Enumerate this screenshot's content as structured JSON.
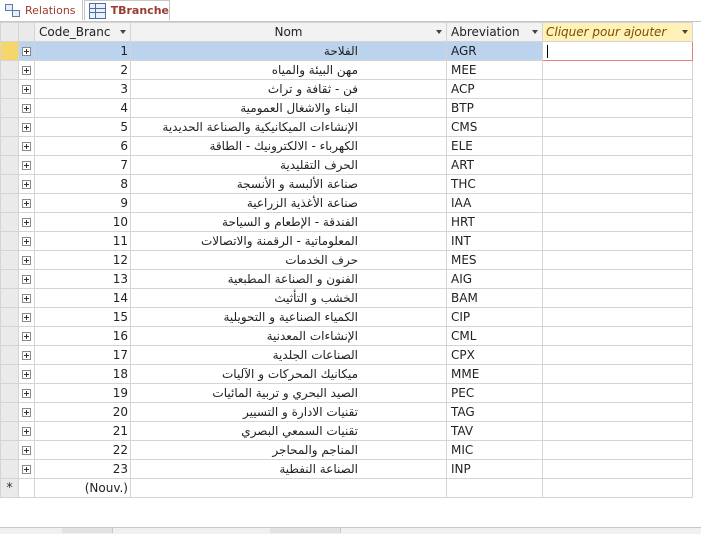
{
  "tabs": [
    {
      "label": "Relations",
      "icon": "relationships-icon",
      "active": false
    },
    {
      "label": "TBranche",
      "icon": "table-icon",
      "active": true
    }
  ],
  "columns": {
    "code": "Code_Branc",
    "nom": "Nom",
    "abreviation": "Abreviation",
    "add": "Cliquer pour ajouter"
  },
  "rows": [
    {
      "code": "1",
      "nom": "الفلاحة",
      "abr": "AGR"
    },
    {
      "code": "2",
      "nom": "مهن البيئة والمياه",
      "abr": "MEE"
    },
    {
      "code": "3",
      "nom": "فن - ثقافة و تراث",
      "abr": "ACP"
    },
    {
      "code": "4",
      "nom": "البناء والاشغال العمومية",
      "abr": "BTP"
    },
    {
      "code": "5",
      "nom": "الإنشاءات الميكانيكية والصناعة الحديدية",
      "abr": "CMS"
    },
    {
      "code": "6",
      "nom": "الكهرباء - الالكترونيك - الطاقة",
      "abr": "ELE"
    },
    {
      "code": "7",
      "nom": "الحرف التقليدية",
      "abr": "ART"
    },
    {
      "code": "8",
      "nom": "صناعة الألبسة و الأنسجة",
      "abr": "THC"
    },
    {
      "code": "9",
      "nom": "صناعة الأغذية الزراعية",
      "abr": "IAA"
    },
    {
      "code": "10",
      "nom": "الفندقة - الإطعام و السياحة",
      "abr": "HRT"
    },
    {
      "code": "11",
      "nom": "المعلوماتية - الرقمنة والاتصالات",
      "abr": "INT"
    },
    {
      "code": "12",
      "nom": "حرف الخدمات",
      "abr": "MES"
    },
    {
      "code": "13",
      "nom": "الفنون و الصناعة المطبعية",
      "abr": "AIG"
    },
    {
      "code": "14",
      "nom": "الخشب و التأثيث",
      "abr": "BAM"
    },
    {
      "code": "15",
      "nom": "الكمياء الصناعية و التحويلية",
      "abr": "CIP"
    },
    {
      "code": "16",
      "nom": "الإنشاءات المعدنية",
      "abr": "CML"
    },
    {
      "code": "17",
      "nom": "الصناعات الجلدية",
      "abr": "CPX"
    },
    {
      "code": "18",
      "nom": "ميكانيك المحركات و الآليات",
      "abr": "MME"
    },
    {
      "code": "19",
      "nom": "الصيد البحري و تربية المائيات",
      "abr": "PEC"
    },
    {
      "code": "20",
      "nom": "تقنيات الادارة و التسيير",
      "abr": "TAG"
    },
    {
      "code": "21",
      "nom": "تقنيات السمعي البصري",
      "abr": "TAV"
    },
    {
      "code": "22",
      "nom": "المناجم والمحاجر",
      "abr": "MIC"
    },
    {
      "code": "23",
      "nom": "الصناعة النفطية",
      "abr": "INP"
    }
  ],
  "new_row": {
    "marker": "*",
    "code": "(Nouv.)"
  },
  "selected_row_index": 0,
  "colors": {
    "selected_row": "#bcd3ee",
    "add_column_header": "#fff1b8",
    "tab_text": "#9b3a2e"
  }
}
